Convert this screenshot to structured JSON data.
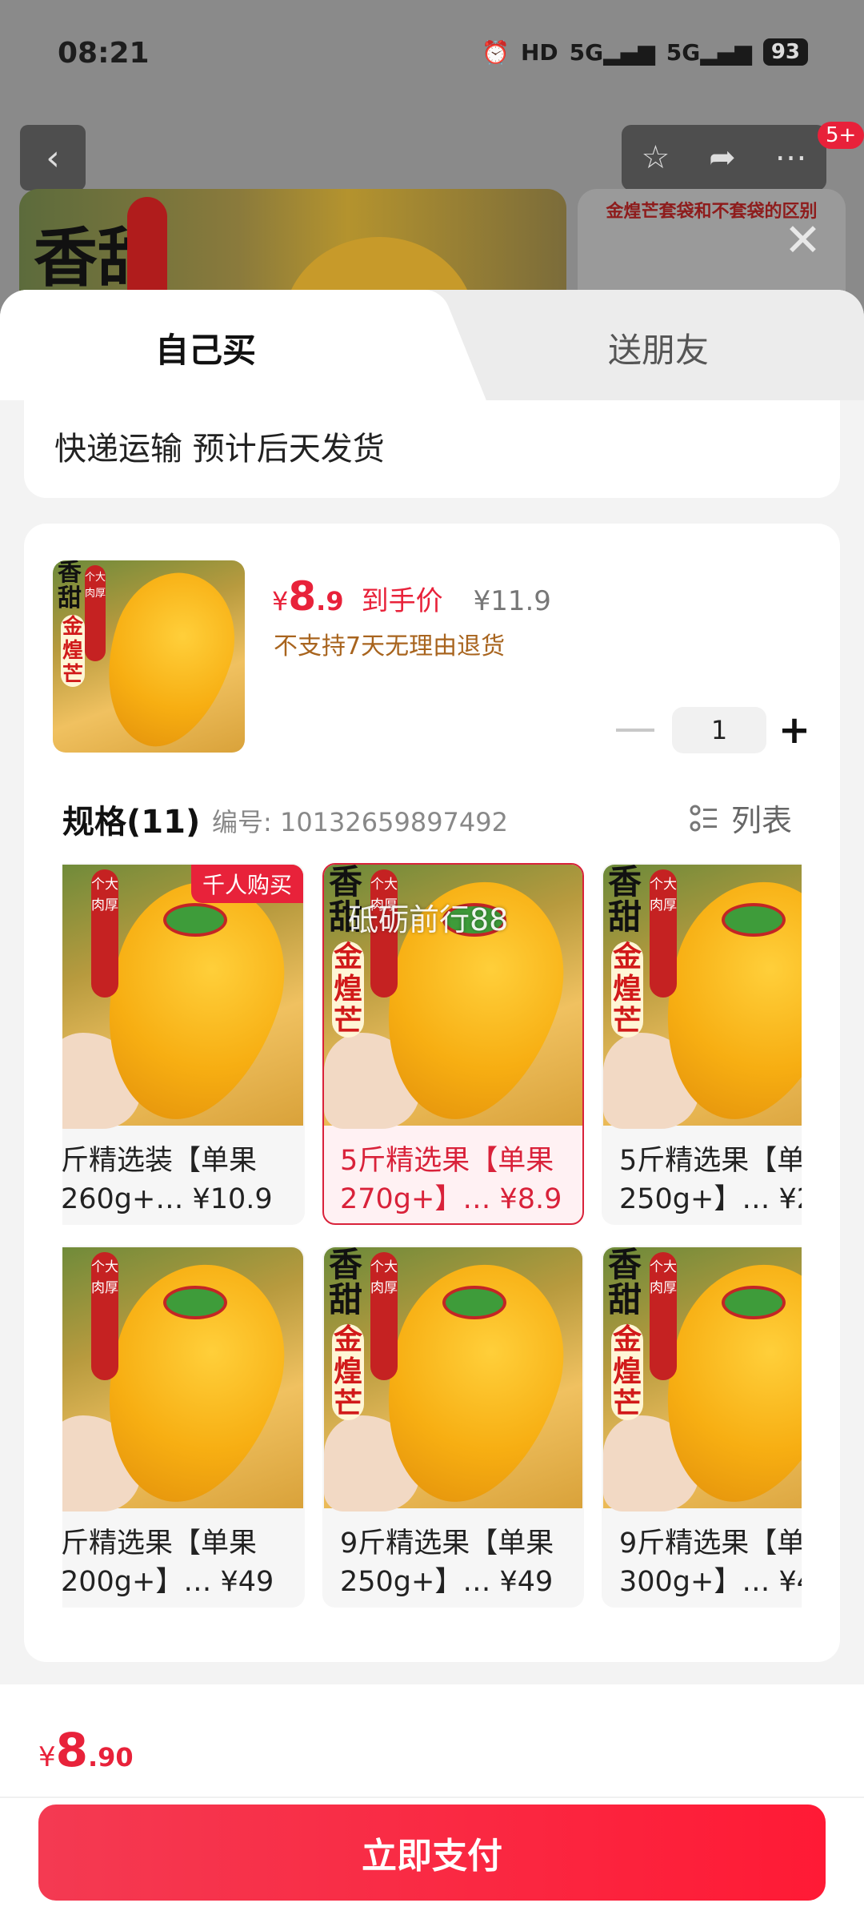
{
  "status_bar": {
    "time": "08:21",
    "network": "HD",
    "signal1": "5G",
    "signal2": "5G",
    "battery": "93"
  },
  "background": {
    "badge": "5+",
    "banner_caption": "金煌芒套袋和不套袋的区别",
    "banner_title": "香甜"
  },
  "tabs": {
    "self_buy": "自己买",
    "gift": "送朋友"
  },
  "shipping": {
    "text": "快递运输 预计后天发货"
  },
  "product": {
    "price_currency": "¥",
    "price_int": "8",
    "price_dec": ".9",
    "price_label": "到手价",
    "original_price": "¥11.9",
    "return_policy": "不支持7天无理由退货",
    "quantity": "1",
    "thumb_title": "香甜",
    "thumb_tag": "个大肉厚",
    "thumb_brand": "金煌芒"
  },
  "specs": {
    "title": "规格(11)",
    "code": "编号: 10132659897492",
    "view_toggle": "列表",
    "watermark": "砥砺前行88",
    "items": [
      {
        "name": "斤精选装【单果\n260g+… ¥10.9",
        "tag": "千人购买"
      },
      {
        "name": "5斤精选果【单果\n270g+】… ¥8.9"
      },
      {
        "name": "5斤精选果【单果\n250g+】… ¥2"
      },
      {
        "name": "斤精选果【单果\n200g+】… ¥49"
      },
      {
        "name": "9斤精选果【单果\n250g+】… ¥49"
      },
      {
        "name": "9斤精选果【单果\n300g+】… ¥4"
      }
    ]
  },
  "footer": {
    "currency": "¥",
    "total_int": "8",
    "total_dec": ".90",
    "pay_button": "立即支付"
  },
  "colors": {
    "accent": "#e8223a",
    "warning_text": "#a8641e"
  }
}
